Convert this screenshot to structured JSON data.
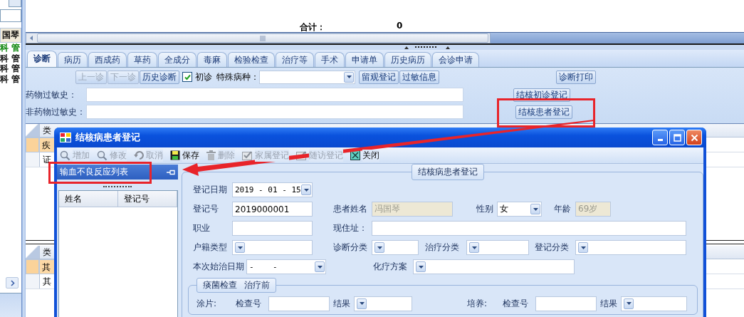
{
  "sidebar": {
    "items": [
      {
        "text": "国琴",
        "selected": true,
        "color": "#000000"
      },
      {
        "text": "科 管",
        "selected": false,
        "color": "#008000"
      },
      {
        "text": "科 管",
        "selected": false,
        "color": "#000000"
      },
      {
        "text": "科 管",
        "selected": false,
        "color": "#000000"
      },
      {
        "text": "科 管",
        "selected": false,
        "color": "#000000"
      }
    ]
  },
  "summary": {
    "label": "合计：",
    "value": "0"
  },
  "tabs": [
    {
      "label": "诊断",
      "selected": true
    },
    {
      "label": "病历",
      "selected": false
    },
    {
      "label": "西成药",
      "selected": false
    },
    {
      "label": "草药",
      "selected": false
    },
    {
      "label": "全成分",
      "selected": false
    },
    {
      "label": "毒麻",
      "selected": false
    },
    {
      "label": "检验检查",
      "selected": false
    },
    {
      "label": "治疗等",
      "selected": false
    },
    {
      "label": "手术",
      "selected": false
    },
    {
      "label": "申请单",
      "selected": false
    },
    {
      "label": "历史病历",
      "selected": false
    },
    {
      "label": "会诊申请",
      "selected": false
    }
  ],
  "diagnosis": {
    "toolbar": [
      {
        "kind": "button",
        "label": "上一诊",
        "disabled": true
      },
      {
        "kind": "button",
        "label": "下一诊",
        "disabled": true
      },
      {
        "kind": "button",
        "label": "历史诊断",
        "disabled": false
      },
      {
        "kind": "checkbox",
        "label": "初诊",
        "checked": true
      },
      {
        "kind": "select",
        "label": "特殊病种："
      },
      {
        "kind": "button",
        "label": "留观登记",
        "disabled": false
      },
      {
        "kind": "button",
        "label": "过敏信息",
        "disabled": false
      }
    ],
    "print_button": "诊断打印",
    "drug_allergy_label": "药物过敏史：",
    "tb_first_button": "结核初诊登记",
    "non_drug_allergy_label": "非药物过敏史：",
    "tb_patient_button": "结核患者登记"
  },
  "diagnosis_grid": {
    "header": "类",
    "rows": [
      {
        "cell": "疾",
        "selected": true
      },
      {
        "cell": "证",
        "selected": false
      }
    ]
  },
  "other_grid": {
    "header": "类",
    "rows": [
      {
        "cell": "其",
        "selected": true
      },
      {
        "cell": "其",
        "selected": false
      }
    ]
  },
  "dialog": {
    "title": "结核病患者登记",
    "toolbar": [
      {
        "kind": "search",
        "label": "增加",
        "disabled": true
      },
      {
        "kind": "search",
        "label": "修改",
        "disabled": true
      },
      {
        "kind": "undo",
        "label": "取消",
        "disabled": true
      },
      {
        "kind": "save",
        "label": "保存",
        "disabled": false
      },
      {
        "kind": "delete",
        "label": "删除",
        "disabled": true
      },
      {
        "kind": "check",
        "label": "家属登记",
        "disabled": true
      },
      {
        "kind": "check",
        "label": "随访登记",
        "disabled": true
      },
      {
        "kind": "close",
        "label": "关闭",
        "disabled": false
      }
    ],
    "side_panel": {
      "title": "输血不良反应列表",
      "columns": [
        "姓名",
        "登记号"
      ]
    },
    "form": {
      "title": "结核病患者登记",
      "rows": [
        {
          "fields": [
            {
              "label": "登记日期",
              "kind": "date",
              "value": "2019 - 01 - 15",
              "disabled": false
            }
          ]
        },
        {
          "fields": [
            {
              "label": "登记号",
              "kind": "text",
              "value": "2019000001",
              "disabled": false
            },
            {
              "label": "患者姓名",
              "kind": "text",
              "value": "冯国琴",
              "disabled": true
            },
            {
              "label": "性别",
              "kind": "select",
              "value": "女",
              "disabled": false
            },
            {
              "label": "年龄",
              "kind": "text",
              "value": "69岁",
              "disabled": true
            }
          ]
        },
        {
          "fields": [
            {
              "label": "职业",
              "kind": "text",
              "disabled": false
            },
            {
              "label": "现住址：",
              "kind": "text",
              "disabled": false
            }
          ]
        },
        {
          "fields": [
            {
              "label": "户籍类型",
              "kind": "select",
              "disabled": false
            },
            {
              "label": "诊断分类",
              "kind": "select",
              "disabled": false
            },
            {
              "label": "治疗分类",
              "kind": "select",
              "disabled": false
            },
            {
              "label": "登记分类",
              "kind": "select",
              "disabled": false
            }
          ]
        },
        {
          "fields": [
            {
              "label": "本次始治日期",
              "kind": "date",
              "value": "-    -",
              "disabled": false
            },
            {
              "label": "化疗方案",
              "kind": "select",
              "disabled": false
            }
          ]
        }
      ]
    },
    "sputum": {
      "title": "痰菌检查",
      "subtitle": "治疗前",
      "groups": [
        {
          "label": "涂片:",
          "number_label": "检查号",
          "result_label": "结果"
        },
        {
          "label": "培养:",
          "number_label": "检查号",
          "result_label": "结果"
        }
      ]
    }
  }
}
